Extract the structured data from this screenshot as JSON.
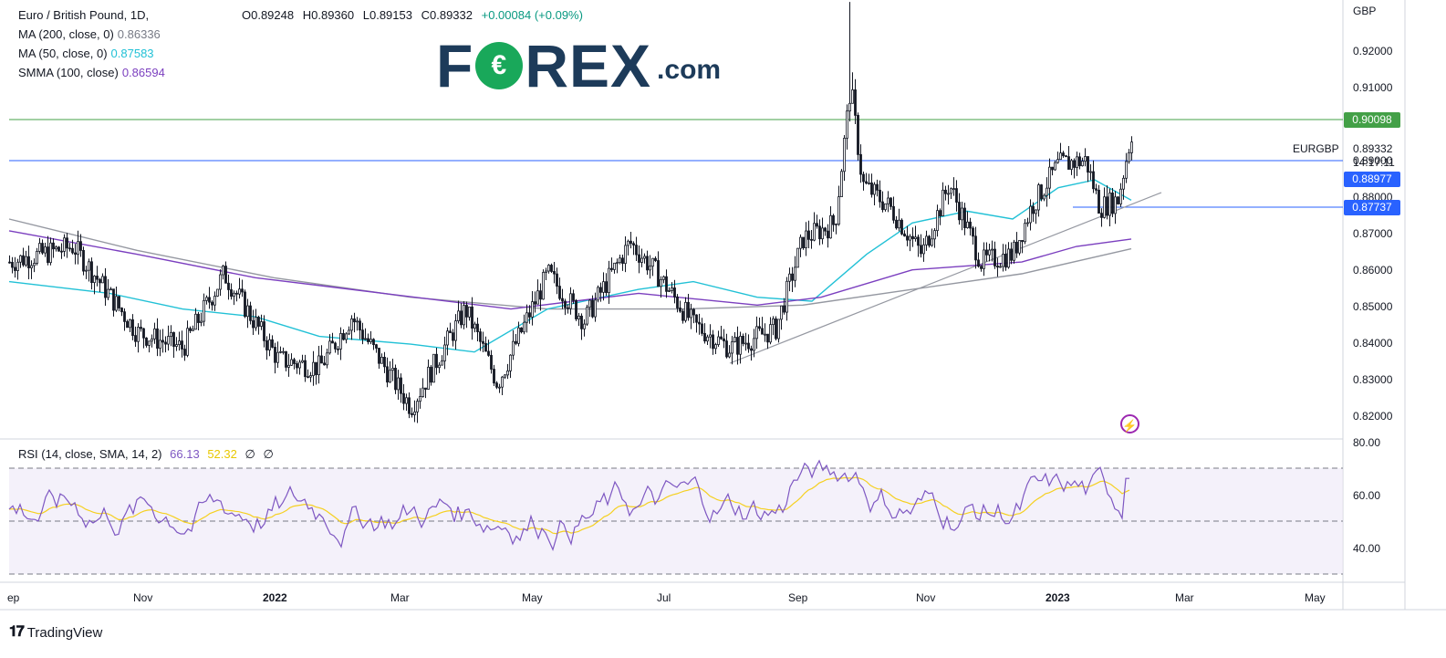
{
  "header": {
    "symbol": "Euro / British Pound, 1D,",
    "open": "O0.89248",
    "high": "H0.89360",
    "low": "L0.89153",
    "close": "C0.89332",
    "change": "+0.00084 (+0.09%)"
  },
  "indicators": [
    {
      "label": "MA (200, close, 0)",
      "value": "0.86336",
      "color": "#787b86"
    },
    {
      "label": "MA (50, close, 0)",
      "value": "0.87583",
      "color": "#22c1d6"
    },
    {
      "label": "SMMA (100, close)",
      "value": "0.86594",
      "color": "#7b3fbf"
    }
  ],
  "logo": {
    "brand": "F",
    "o": "O",
    "rest": "REX",
    "suffix": ".com"
  },
  "currency": "GBP",
  "price_axis": [
    "0.92000",
    "0.91000",
    "0.90000",
    "0.89000",
    "0.88000",
    "0.87000",
    "0.86000",
    "0.85000",
    "0.84000",
    "0.83000",
    "0.82000"
  ],
  "price_tags": [
    {
      "value": "0.90098",
      "color": "#43a047"
    },
    {
      "value": "0.88977",
      "color": "#2962ff"
    },
    {
      "value": "0.87737",
      "color": "#2962ff"
    }
  ],
  "last": {
    "symbol": "EURGBP",
    "price": "0.89332",
    "countdown": "14:17:11"
  },
  "time_axis": [
    "ep",
    "Nov",
    "2022",
    "Mar",
    "May",
    "Jul",
    "Sep",
    "Nov",
    "2023",
    "Mar",
    "May"
  ],
  "rsi": {
    "label": "RSI (14, close, SMA, 14, 2)",
    "value": "66.13",
    "sma": "52.32",
    "extra1": "∅",
    "extra2": "∅",
    "axis": [
      "80.00",
      "60.00",
      "40.00"
    ]
  },
  "footer": {
    "brand": "TradingView"
  },
  "chart_data": {
    "type": "line",
    "title": "Euro / British Pound, 1D",
    "ylim": [
      0.815,
      0.927
    ],
    "levels": [
      0.90098,
      0.88977,
      0.87737
    ],
    "series": [
      {
        "name": "EURGBP",
        "x": [
          "Sep",
          "Nov",
          "2022",
          "Mar",
          "May",
          "Jul",
          "Sep",
          "Nov",
          "2023",
          "Mar"
        ],
        "values": [
          0.86,
          0.845,
          0.836,
          0.832,
          0.852,
          0.852,
          0.869,
          0.874,
          0.883,
          0.893
        ]
      },
      {
        "name": "MA (200, close, 0)",
        "values": [
          0.869,
          0.86,
          0.856,
          0.852,
          0.849,
          0.848,
          0.85,
          0.856,
          0.86,
          0.863
        ]
      },
      {
        "name": "MA (50, close, 0)",
        "values": [
          0.855,
          0.851,
          0.846,
          0.838,
          0.846,
          0.854,
          0.852,
          0.866,
          0.872,
          0.876
        ]
      },
      {
        "name": "SMMA (100, close)",
        "values": [
          0.868,
          0.859,
          0.853,
          0.849,
          0.848,
          0.849,
          0.852,
          0.86,
          0.863,
          0.866
        ]
      }
    ],
    "rsi_ylim": [
      30,
      80
    ]
  }
}
